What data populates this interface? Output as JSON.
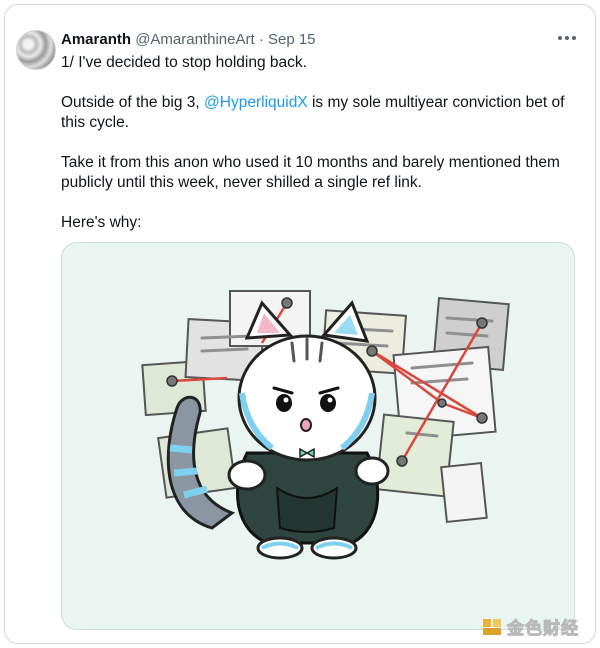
{
  "tweet": {
    "author_name": "Amaranth",
    "handle": "@AmaranthineArt",
    "separator": "·",
    "date": "Sep 15",
    "more_icon": "more-horizontal-icon",
    "line1": "1/ I've decided to stop holding back.",
    "para2_before": "Outside of the big 3, ",
    "mention": "@HyperliquidX",
    "para2_after": " is my sole multiyear conviction bet of this cycle.",
    "para3": "Take it from this anon who used it 10 months and barely mentioned them publicly until this week, never shilled a single ref link.",
    "para4": "Here's why:"
  },
  "media": {
    "description_icon": "cat-detective-board-illustration"
  },
  "watermark": {
    "text": "金色财经"
  },
  "colors": {
    "mention": "#1d9bf0",
    "name": "#0f1419",
    "muted": "#536471",
    "media_bg": "#eaf5f1",
    "string_red": "#d9483b"
  }
}
